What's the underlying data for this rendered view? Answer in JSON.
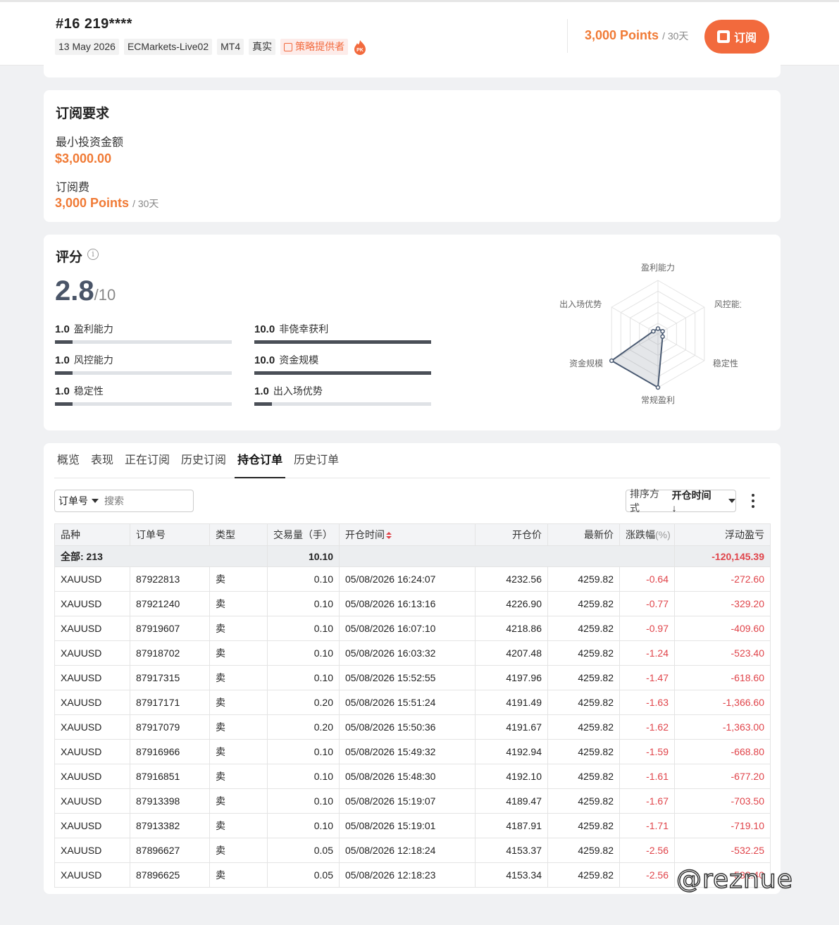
{
  "header": {
    "account_title": "#16  219****",
    "tags": [
      "13 May 2026",
      "ECMarkets-Live02",
      "MT4",
      "真实"
    ],
    "provider_tag": "策略提供者",
    "pk_label": "PK",
    "price": "3,000 Points",
    "price_period": "/ 30天",
    "subscribe_label": "订阅"
  },
  "requirements": {
    "title": "订阅要求",
    "min_invest_label": "最小投资金额",
    "min_invest_value": "$3,000.00",
    "fee_label": "订阅费",
    "fee_value": "3,000 Points",
    "fee_period": "/ 30天"
  },
  "score": {
    "title": "评分",
    "info_icon": "i",
    "value": "2.8",
    "max": "/10",
    "metrics": [
      {
        "num": "1.0",
        "name": "盈利能力",
        "level": 0.1
      },
      {
        "num": "10.0",
        "name": "非侥幸获利",
        "level": 1.0
      },
      {
        "num": "1.0",
        "name": "风控能力",
        "level": 0.1
      },
      {
        "num": "10.0",
        "name": "资金规模",
        "level": 1.0
      },
      {
        "num": "1.0",
        "name": "稳定性",
        "level": 0.1
      },
      {
        "num": "1.0",
        "name": "出入场优势",
        "level": 0.1
      }
    ],
    "radar": {
      "axes": [
        "盈利能力",
        "风控能力",
        "稳定性",
        "常规盈利",
        "资金规模",
        "出入场优势"
      ],
      "values": [
        1.0,
        1.0,
        1.0,
        10.0,
        10.0,
        1.0
      ],
      "max": 10
    }
  },
  "orders": {
    "tabs": [
      "概览",
      "表现",
      "正在订阅",
      "历史订阅",
      "持仓订单",
      "历史订单"
    ],
    "active_tab": "持仓订单",
    "filter_select": "订单号",
    "search_placeholder": "搜索",
    "sort_label": "排序方式",
    "sort_value": "开仓时间 ↓",
    "columns": [
      "品种",
      "订单号",
      "类型",
      "交易量（手）",
      "开仓时间",
      "开仓价",
      "最新价",
      "涨跌幅",
      "(%)",
      "浮动盈亏"
    ],
    "total": {
      "label": "全部: 213",
      "volume": "10.10",
      "pnl": "-120,145.39"
    },
    "rows": [
      [
        "XAUUSD",
        "87922813",
        "卖",
        "0.10",
        "05/08/2026 16:24:07",
        "4232.56",
        "4259.82",
        "-0.64",
        "-272.60"
      ],
      [
        "XAUUSD",
        "87921240",
        "卖",
        "0.10",
        "05/08/2026 16:13:16",
        "4226.90",
        "4259.82",
        "-0.77",
        "-329.20"
      ],
      [
        "XAUUSD",
        "87919607",
        "卖",
        "0.10",
        "05/08/2026 16:07:10",
        "4218.86",
        "4259.82",
        "-0.97",
        "-409.60"
      ],
      [
        "XAUUSD",
        "87918702",
        "卖",
        "0.10",
        "05/08/2026 16:03:32",
        "4207.48",
        "4259.82",
        "-1.24",
        "-523.40"
      ],
      [
        "XAUUSD",
        "87917315",
        "卖",
        "0.10",
        "05/08/2026 15:52:55",
        "4197.96",
        "4259.82",
        "-1.47",
        "-618.60"
      ],
      [
        "XAUUSD",
        "87917171",
        "卖",
        "0.20",
        "05/08/2026 15:51:24",
        "4191.49",
        "4259.82",
        "-1.63",
        "-1,366.60"
      ],
      [
        "XAUUSD",
        "87917079",
        "卖",
        "0.20",
        "05/08/2026 15:50:36",
        "4191.67",
        "4259.82",
        "-1.62",
        "-1,363.00"
      ],
      [
        "XAUUSD",
        "87916966",
        "卖",
        "0.10",
        "05/08/2026 15:49:32",
        "4192.94",
        "4259.82",
        "-1.59",
        "-668.80"
      ],
      [
        "XAUUSD",
        "87916851",
        "卖",
        "0.10",
        "05/08/2026 15:48:30",
        "4192.10",
        "4259.82",
        "-1.61",
        "-677.20"
      ],
      [
        "XAUUSD",
        "87913398",
        "卖",
        "0.10",
        "05/08/2026 15:19:07",
        "4189.47",
        "4259.82",
        "-1.67",
        "-703.50"
      ],
      [
        "XAUUSD",
        "87913382",
        "卖",
        "0.10",
        "05/08/2026 15:19:01",
        "4187.91",
        "4259.82",
        "-1.71",
        "-719.10"
      ],
      [
        "XAUUSD",
        "87896627",
        "卖",
        "0.05",
        "05/08/2026 12:18:24",
        "4153.37",
        "4259.82",
        "-2.56",
        "-532.25"
      ],
      [
        "XAUUSD",
        "87896625",
        "卖",
        "0.05",
        "05/08/2026 12:18:23",
        "4153.34",
        "4259.82",
        "-2.56",
        "-532.40"
      ]
    ]
  },
  "watermark": "@reznue",
  "colors": {
    "accent": "#f26a3d",
    "price": "#f07a35",
    "negative": "#e0444a"
  }
}
